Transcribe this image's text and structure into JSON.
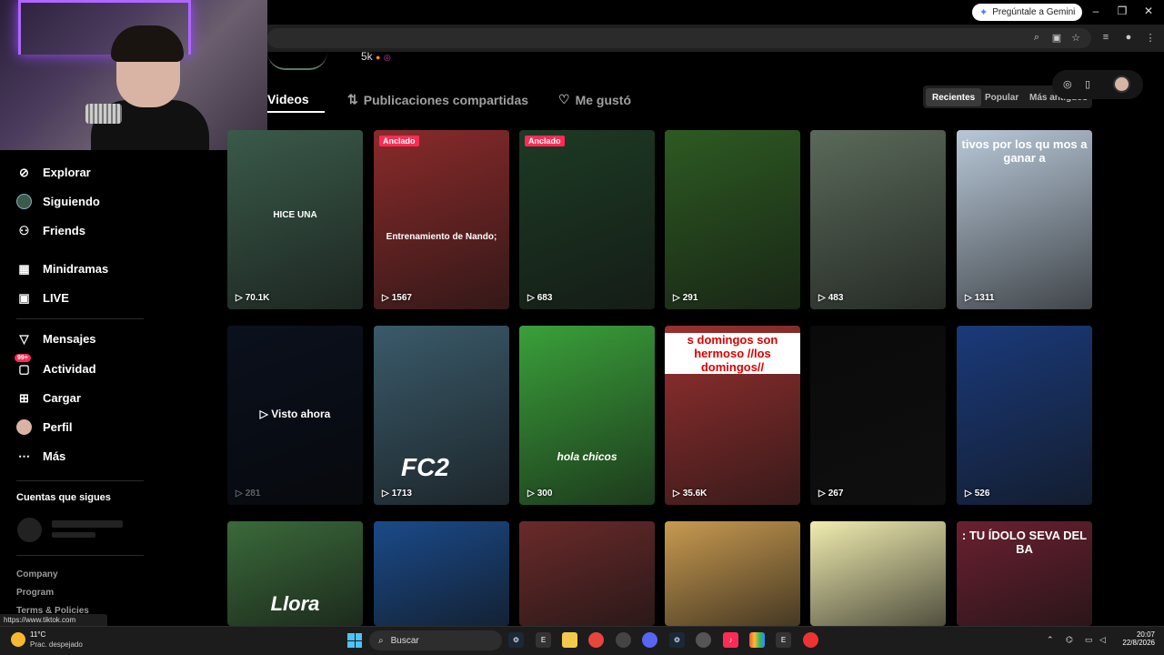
{
  "browser": {
    "gemini_label": "Pregúntale a Gemini",
    "status_url": "https://www.tiktok.com"
  },
  "profile": {
    "followers_text": "5k"
  },
  "tabs": [
    {
      "label": "Videos",
      "active": true
    },
    {
      "label": "Publicaciones compartidas",
      "active": false
    },
    {
      "label": "Me gustó",
      "active": false
    }
  ],
  "sort": {
    "options": [
      "Recientes",
      "Popular",
      "Más antiguos"
    ],
    "selected": "Recientes"
  },
  "sidebar": {
    "items": [
      {
        "label": "Explorar",
        "icon": "compass-icon"
      },
      {
        "label": "Siguiendo",
        "icon": "following-avatar-icon"
      },
      {
        "label": "Friends",
        "icon": "friends-icon"
      },
      {
        "label": "Minidramas",
        "icon": "film-icon"
      },
      {
        "label": "LIVE",
        "icon": "live-tv-icon"
      },
      {
        "label": "Mensajes",
        "icon": "send-icon"
      },
      {
        "label": "Actividad",
        "icon": "activity-icon",
        "badge": "99+"
      },
      {
        "label": "Cargar",
        "icon": "upload-icon"
      },
      {
        "label": "Perfil",
        "icon": "profile-avatar-icon"
      },
      {
        "label": "Más",
        "icon": "more-icon"
      }
    ],
    "following_title": "Cuentas que sigues",
    "footer": [
      "Company",
      "Program",
      "Terms & Policies"
    ]
  },
  "videos": [
    {
      "views": "70.1K",
      "caption": "HICE UNA",
      "pinned": false,
      "bg": "#3a5a4a"
    },
    {
      "views": "1567",
      "caption": "Entrenamiento de Nando;",
      "pinned": true,
      "pin_label": "Anclado",
      "bg": "#8a2a2a"
    },
    {
      "views": "683",
      "caption": "",
      "pinned": true,
      "pin_label": "Anclado",
      "bg": "#1d3a24"
    },
    {
      "views": "291",
      "caption": "",
      "pinned": false,
      "bg": "#2d5a22"
    },
    {
      "views": "483",
      "caption": "",
      "pinned": false,
      "bg": "#5a6a5a"
    },
    {
      "views": "1311",
      "caption": "tivos por los qu mos a ganar a",
      "pinned": false,
      "bg": "#b8c8d8"
    },
    {
      "views": "281",
      "caption": "",
      "pinned": false,
      "watched": "Visto ahora",
      "bg": "#1a2a4a"
    },
    {
      "views": "1713",
      "caption": "FC2",
      "pinned": false,
      "bg": "#3a5a6a"
    },
    {
      "views": "300",
      "caption": "hola chicos",
      "pinned": false,
      "bg": "#3aa03a"
    },
    {
      "views": "35.6K",
      "caption": "s domingos son hermoso //los domingos//",
      "pinned": false,
      "bg": "#9a3030"
    },
    {
      "views": "267",
      "caption": "",
      "pinned": false,
      "bg": "#0a0a0a"
    },
    {
      "views": "526",
      "caption": "",
      "pinned": false,
      "bg": "#1a3a7a"
    },
    {
      "views": "",
      "caption": "Llora",
      "pinned": false,
      "bg": "#3a6a3a"
    },
    {
      "views": "",
      "caption": "",
      "pinned": false,
      "bg": "#1a4a8a"
    },
    {
      "views": "",
      "caption": "",
      "pinned": false,
      "bg": "#6a2a2a"
    },
    {
      "views": "",
      "caption": "",
      "pinned": false,
      "bg": "#c89a50"
    },
    {
      "views": "",
      "caption": "",
      "pinned": false,
      "bg": "#f0ecb0"
    },
    {
      "views": "",
      "caption": ": TU ÍDOLO SEVA DEL BA",
      "pinned": false,
      "bg": "#6a2030"
    }
  ],
  "taskbar": {
    "temp": "11°C",
    "weather": "Prac. despejado",
    "search_placeholder": "Buscar",
    "time": "20:07",
    "date": "22/8/2026"
  },
  "colors": {
    "accent": "#fe2c55",
    "background": "#000000",
    "sidebar_text": "#ffffff"
  }
}
